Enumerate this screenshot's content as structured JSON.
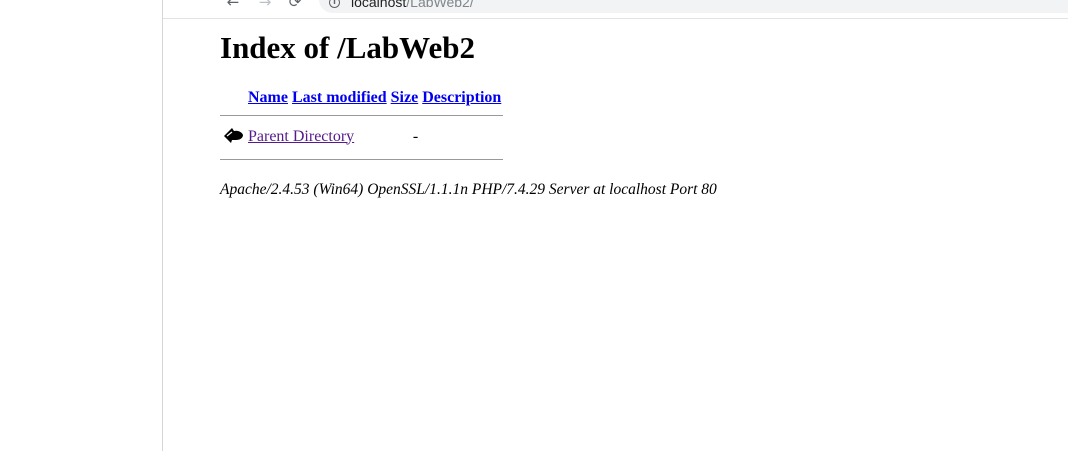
{
  "browser": {
    "url_host": "localhost",
    "url_path": "/LabWeb2/"
  },
  "page": {
    "title": "Index of /LabWeb2",
    "columns": {
      "name": "Name",
      "last_modified": "Last modified",
      "size": "Size",
      "description": "Description"
    },
    "rows": [
      {
        "name": "Parent Directory",
        "last_modified": "",
        "size": "-",
        "description": ""
      }
    ],
    "footer": "Apache/2.4.53 (Win64) OpenSSL/1.1.1n PHP/7.4.29 Server at localhost Port 80"
  },
  "icons": {
    "parent": "back-arrow-icon"
  }
}
